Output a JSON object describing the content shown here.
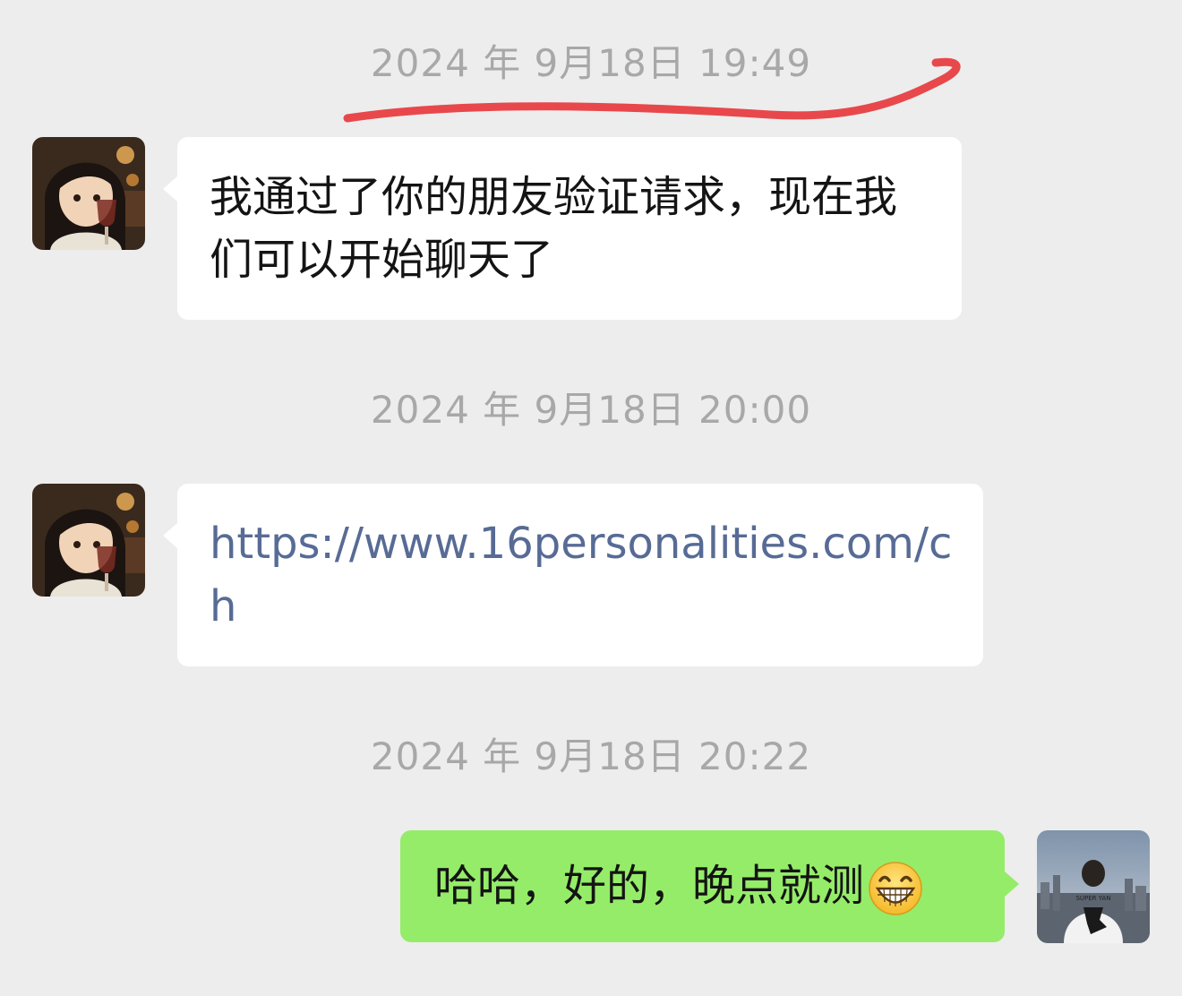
{
  "chat": {
    "messages": [
      {
        "timestamp": "2024 年 9月18日 19:49",
        "sender": "contact",
        "text": "我通过了你的朋友验证请求，现在我们可以开始聊天了"
      },
      {
        "timestamp": "2024 年 9月18日 20:00",
        "sender": "contact",
        "text": "https://www.16personalities.com/ch"
      },
      {
        "timestamp": "2024 年 9月18日 20:22",
        "sender": "me",
        "text": "哈哈，好的，晚点就测",
        "emoji": "grinning-face-emoji"
      }
    ],
    "my_avatar_shirt_text": "SUPER YAN"
  },
  "colors": {
    "background": "#ededed",
    "incoming_bubble": "#ffffff",
    "outgoing_bubble": "#95ec69",
    "link": "#576b95",
    "timestamp": "#a8a8a8",
    "annotation_stroke": "#e8484b"
  },
  "icons": {
    "contact_avatar": "anime-girl-avatar-icon",
    "my_avatar": "city-skyline-avatar-icon"
  }
}
